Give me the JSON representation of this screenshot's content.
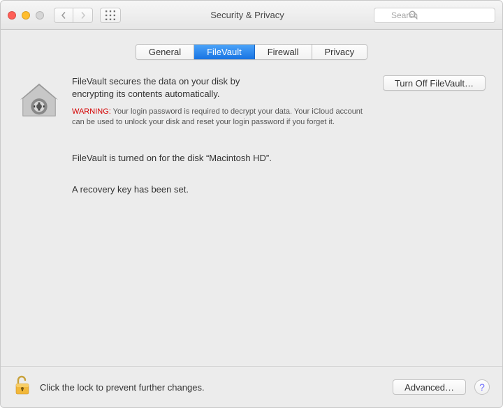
{
  "window": {
    "title": "Security & Privacy",
    "search_placeholder": "Search"
  },
  "tabs": {
    "general": "General",
    "filevault": "FileVault",
    "firewall": "Firewall",
    "privacy": "Privacy"
  },
  "main": {
    "heading_line1": "FileVault secures the data on your disk by",
    "heading_line2": "encrypting its contents automatically.",
    "turn_off_label": "Turn Off FileVault…",
    "warning_label": "WARNING:",
    "warning_text": " Your login password is required to decrypt your data. Your iCloud account can be used to unlock your disk and reset your login password if you forget it.",
    "status_disk": "FileVault is turned on for the disk “Macintosh HD”.",
    "status_recovery": "A recovery key has been set."
  },
  "footer": {
    "lock_text": "Click the lock to prevent further changes.",
    "advanced_label": "Advanced…",
    "help_label": "?"
  }
}
